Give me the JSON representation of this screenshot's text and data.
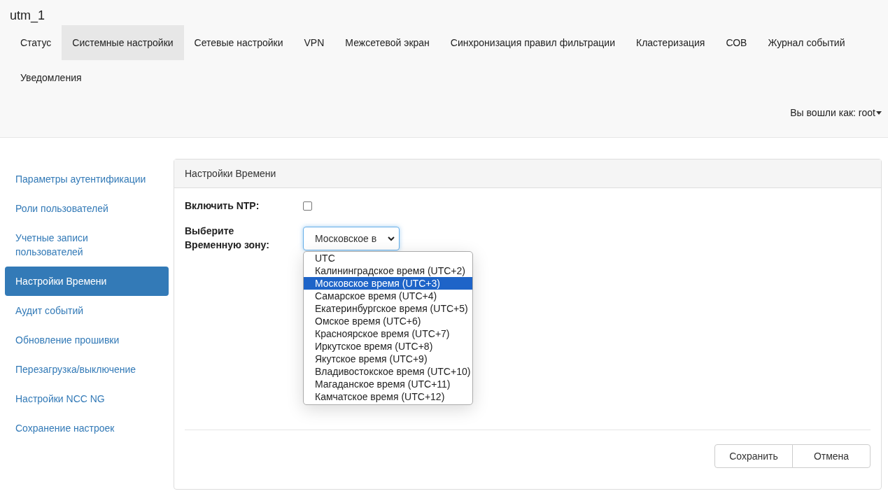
{
  "brand": "utm_1",
  "nav": [
    {
      "label": "Статус",
      "selected": false
    },
    {
      "label": "Системные настройки",
      "selected": true
    },
    {
      "label": "Сетевые настройки",
      "selected": false
    },
    {
      "label": "VPN",
      "selected": false
    },
    {
      "label": "Межсетевой экран",
      "selected": false
    },
    {
      "label": "Синхронизация правил фильтрации",
      "selected": false
    },
    {
      "label": "Кластеризация",
      "selected": false
    },
    {
      "label": "СОВ",
      "selected": false
    },
    {
      "label": "Журнал событий",
      "selected": false
    },
    {
      "label": "Уведомления",
      "selected": false
    }
  ],
  "user_menu": "Вы вошли как: root",
  "sidebar": [
    {
      "label": "Параметры аутентификации",
      "selected": false
    },
    {
      "label": "Роли пользователей",
      "selected": false
    },
    {
      "label": "Учетные записи пользователей",
      "selected": false
    },
    {
      "label": "Настройки Времени",
      "selected": true
    },
    {
      "label": "Аудит событий",
      "selected": false
    },
    {
      "label": "Обновление прошивки",
      "selected": false
    },
    {
      "label": "Перезагрузка/выключение",
      "selected": false
    },
    {
      "label": "Настройки NCC NG",
      "selected": false
    },
    {
      "label": "Сохранение настроек",
      "selected": false
    }
  ],
  "panel": {
    "title": "Настройки Времени",
    "ntp": {
      "label": "Включить NTP:",
      "checked": false
    },
    "timezone": {
      "label": "Выберите Временную зону:",
      "value": "Московское в",
      "expanded": true,
      "options": [
        {
          "label": "UTC",
          "selected": false
        },
        {
          "label": "Калининградское время (UTC+2)",
          "selected": false
        },
        {
          "label": "Московское время (UTC+3)",
          "selected": true
        },
        {
          "label": "Самарское время (UTC+4)",
          "selected": false
        },
        {
          "label": "Екатеринбургское время (UTC+5)",
          "selected": false
        },
        {
          "label": "Омское время (UTC+6)",
          "selected": false
        },
        {
          "label": "Красноярское время (UTC+7)",
          "selected": false
        },
        {
          "label": "Иркутское время (UTC+8)",
          "selected": false
        },
        {
          "label": "Якутское время (UTC+9)",
          "selected": false
        },
        {
          "label": "Владивостокское время (UTC+10)",
          "selected": false
        },
        {
          "label": "Магаданское время (UTC+11)",
          "selected": false
        },
        {
          "label": "Камчатское время (UTC+12)",
          "selected": false
        }
      ]
    },
    "buttons": [
      "Сохранить",
      "Отмена"
    ]
  }
}
